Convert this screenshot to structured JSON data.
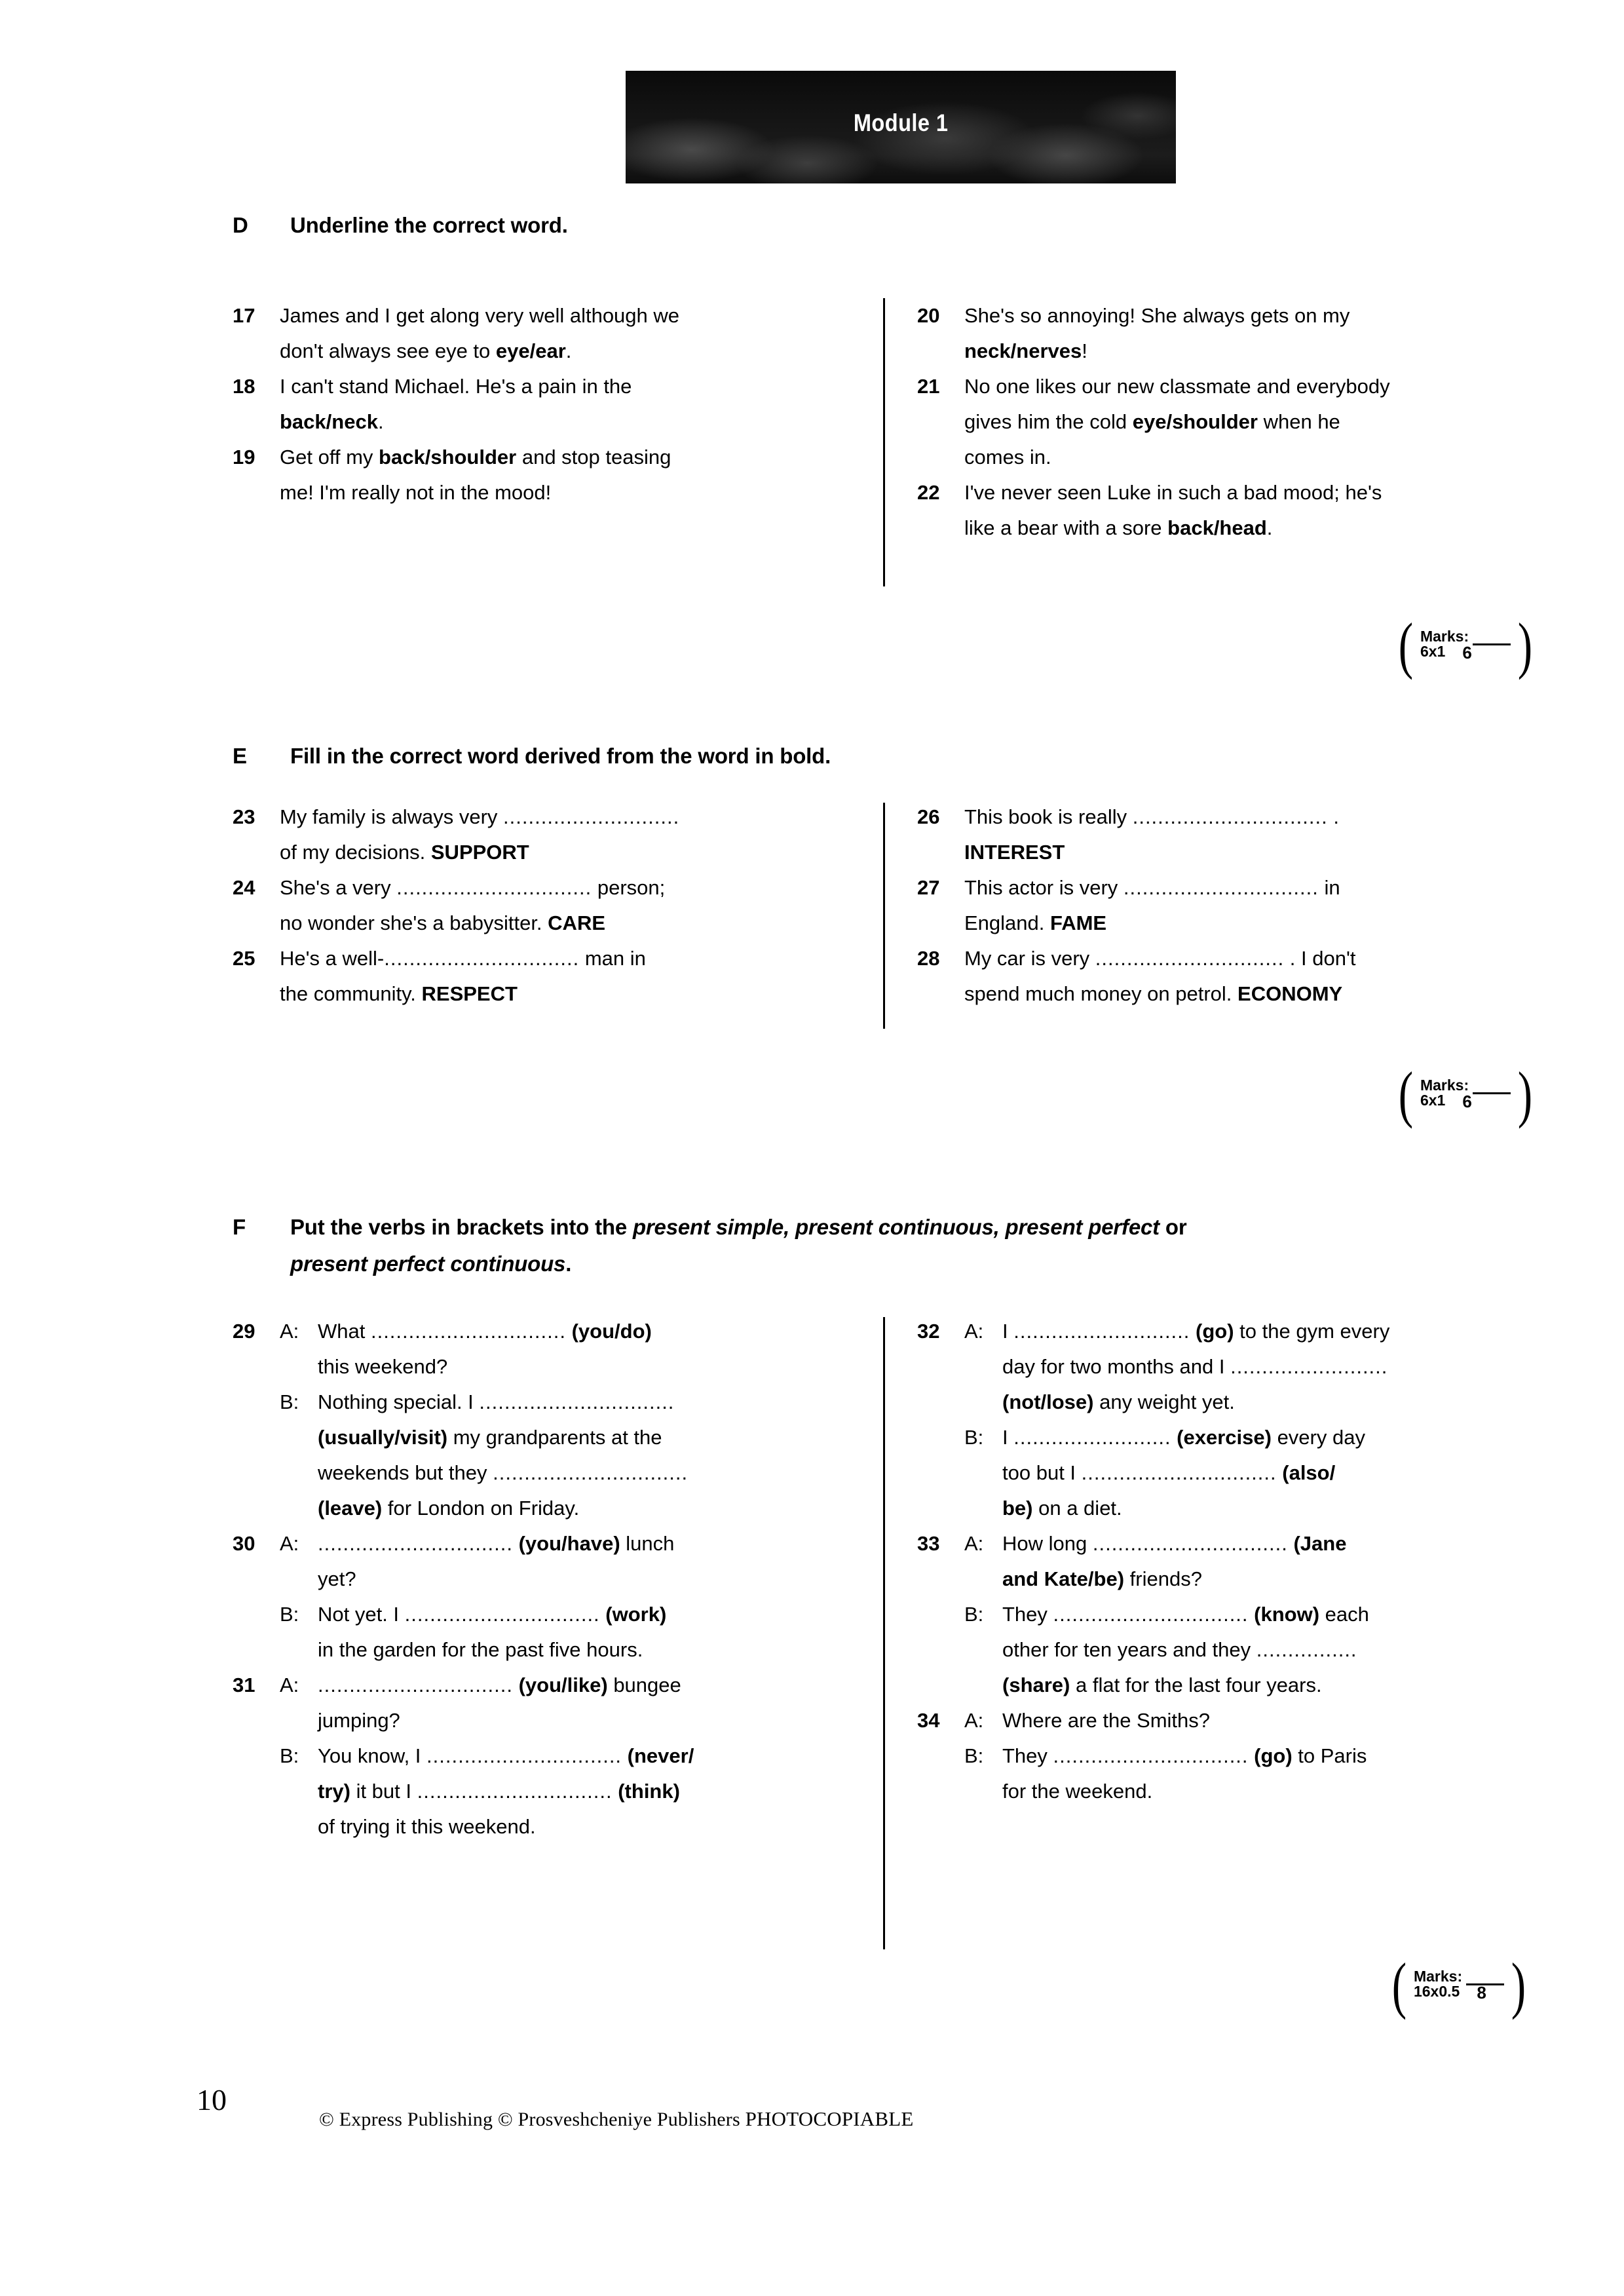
{
  "banner": {
    "title": "Module 1"
  },
  "exercises": [
    {
      "letter": "D",
      "instruction": "Underline the correct word.",
      "left": [
        {
          "num": "17",
          "line1": "James and I get along very well although we",
          "line2_pre": "don't always see eye to ",
          "line2_bold": "eye/ear",
          "line2_post": "."
        },
        {
          "num": "18",
          "line1": "I can't stand Michael. He's a pain in the",
          "line2_pre": "",
          "line2_bold": "back/neck",
          "line2_post": "."
        },
        {
          "num": "19",
          "line1_pre": "Get off my ",
          "line1_bold": "back/shoulder",
          "line1_post": " and stop teasing",
          "line2": "me! I'm really not in the mood!"
        }
      ],
      "right": [
        {
          "num": "20",
          "line1": "She's so annoying! She always gets on my",
          "line2_bold": "neck/nerves",
          "line2_post": "!"
        },
        {
          "num": "21",
          "line1": "No one likes our new classmate and everybody",
          "line2_pre": "gives him the cold ",
          "line2_bold": "eye/shoulder",
          "line2_post": " when he",
          "line3": "comes in."
        },
        {
          "num": "22",
          "line1": "I've never seen Luke in such a bad mood; he's",
          "line2_pre": "like a bear with a sore ",
          "line2_bold": "back/head",
          "line2_post": "."
        }
      ],
      "marks": {
        "label": "Marks:",
        "multiplier": "6x1",
        "total": "6"
      }
    },
    {
      "letter": "E",
      "instruction": "Fill in the correct word derived from the word in bold.",
      "left": [
        {
          "num": "23",
          "line1_pre": "My family is always very ",
          "dots": "............................",
          "line2_pre": "of my decisions.  ",
          "line2_bold": "SUPPORT"
        },
        {
          "num": "24",
          "line1_pre": "She's a very ",
          "dots": "...............................",
          "line1_post": " person;",
          "line2_pre": "no wonder she's a babysitter.  ",
          "line2_bold": "CARE"
        },
        {
          "num": "25",
          "line1_pre": "He's a well-",
          "dots": "...............................",
          "line1_post": " man in",
          "line2_pre": "the community.  ",
          "line2_bold": "RESPECT"
        }
      ],
      "right": [
        {
          "num": "26",
          "line1_pre": "This book is really ",
          "dots": "...............................",
          "line1_post": " .",
          "line2_bold": "INTEREST"
        },
        {
          "num": "27",
          "line1_pre": "This actor is very ",
          "dots": "...............................",
          "line1_post": " in",
          "line2_pre": "England.  ",
          "line2_bold": "FAME"
        },
        {
          "num": "28",
          "line1_pre": "My car is very ",
          "dots": "..............................",
          "line1_post": " . I don't",
          "line2_pre": "spend much money on petrol.  ",
          "line2_bold": "ECONOMY"
        }
      ],
      "marks": {
        "label": "Marks:",
        "multiplier": "6x1",
        "total": "6"
      }
    },
    {
      "letter": "F",
      "instruction_pre": "Put the verbs in brackets into the ",
      "instruction_italic1": "present simple, present continuous, present perfect",
      "instruction_mid": " or",
      "instruction_italic2": "present perfect continuous",
      "instruction_post": ".",
      "marks": {
        "label": "Marks:",
        "multiplier": "16x0.5",
        "total": "8"
      }
    }
  ],
  "exF": {
    "left": [
      {
        "num": "29",
        "lines": [
          {
            "speaker": "A:",
            "pre": "What  ",
            "dots": "...............................",
            "bold": " (you/do)"
          },
          {
            "speaker": "",
            "pre": "this weekend?"
          },
          {
            "speaker": "B:",
            "pre": "Nothing special. I ",
            "dots": "..............................."
          },
          {
            "speaker": "",
            "bold": "(usually/visit)",
            "post": " my  grandparents  at  the"
          },
          {
            "speaker": "",
            "pre": "weekends but they ",
            "dots": "..............................."
          },
          {
            "speaker": "",
            "bold": "(leave)",
            "post": " for London on Friday."
          }
        ]
      },
      {
        "num": "30",
        "lines": [
          {
            "speaker": "A:",
            "dots": "...............................",
            "bold": " (you/have)",
            "post": " lunch"
          },
          {
            "speaker": "",
            "pre": "yet?"
          },
          {
            "speaker": "B:",
            "pre": "Not yet. I ",
            "dots": "...............................",
            "bold": " (work)"
          },
          {
            "speaker": "",
            "pre": "in the garden for the past five hours."
          }
        ]
      },
      {
        "num": "31",
        "lines": [
          {
            "speaker": "A:",
            "dots": "...............................",
            "bold": " (you/like)",
            "post": " bungee"
          },
          {
            "speaker": "",
            "pre": "jumping?"
          },
          {
            "speaker": "B:",
            "pre": "You know, I ",
            "dots": "...............................",
            "bold": " (never/"
          },
          {
            "speaker": "",
            "bold": "try)",
            "post": " it but I ",
            "dots2": "...............................",
            "bold2": " (think)"
          },
          {
            "speaker": "",
            "pre": "of trying it this weekend."
          }
        ]
      }
    ],
    "right": [
      {
        "num": "32",
        "lines": [
          {
            "speaker": "A:",
            "pre": "I ",
            "dots": "............................",
            "bold": " (go)",
            "post": " to the gym every"
          },
          {
            "speaker": "",
            "pre": "day for two months and I ",
            "dots": "........................."
          },
          {
            "speaker": "",
            "bold": "(not/lose)",
            "post": " any weight yet."
          },
          {
            "speaker": "B:",
            "pre": "I ",
            "dots": ".........................",
            "bold": " (exercise)",
            "post": " every day"
          },
          {
            "speaker": "",
            "pre": "too  but  I  ",
            "dots": "...............................",
            "bold": " (also/"
          },
          {
            "speaker": "",
            "bold": "be)",
            "post": " on a diet."
          }
        ]
      },
      {
        "num": "33",
        "lines": [
          {
            "speaker": "A:",
            "pre": "How  long  ",
            "dots": "...............................",
            "bold": " (Jane"
          },
          {
            "speaker": "",
            "bold": "and Kate/be)",
            "post": " friends?"
          },
          {
            "speaker": "B:",
            "pre": "They ",
            "dots": "...............................",
            "bold": " (know)",
            "post": " each"
          },
          {
            "speaker": "",
            "pre": "other for ten years and they ",
            "dots": "................"
          },
          {
            "speaker": "",
            "bold": "(share)",
            "post": " a flat for the last four years."
          }
        ]
      },
      {
        "num": "34",
        "lines": [
          {
            "speaker": "A:",
            "pre": "Where are the Smiths?"
          },
          {
            "speaker": "B:",
            "pre": "They ",
            "dots": "...............................",
            "bold": " (go)",
            "post": " to Paris"
          },
          {
            "speaker": "",
            "pre": "for the weekend."
          }
        ]
      }
    ]
  },
  "footer": {
    "page_number": "10",
    "copyright": "© Express Publishing © Prosveshcheniye Publishers",
    "photocopiable": "PHOTOCOPIABLE"
  }
}
